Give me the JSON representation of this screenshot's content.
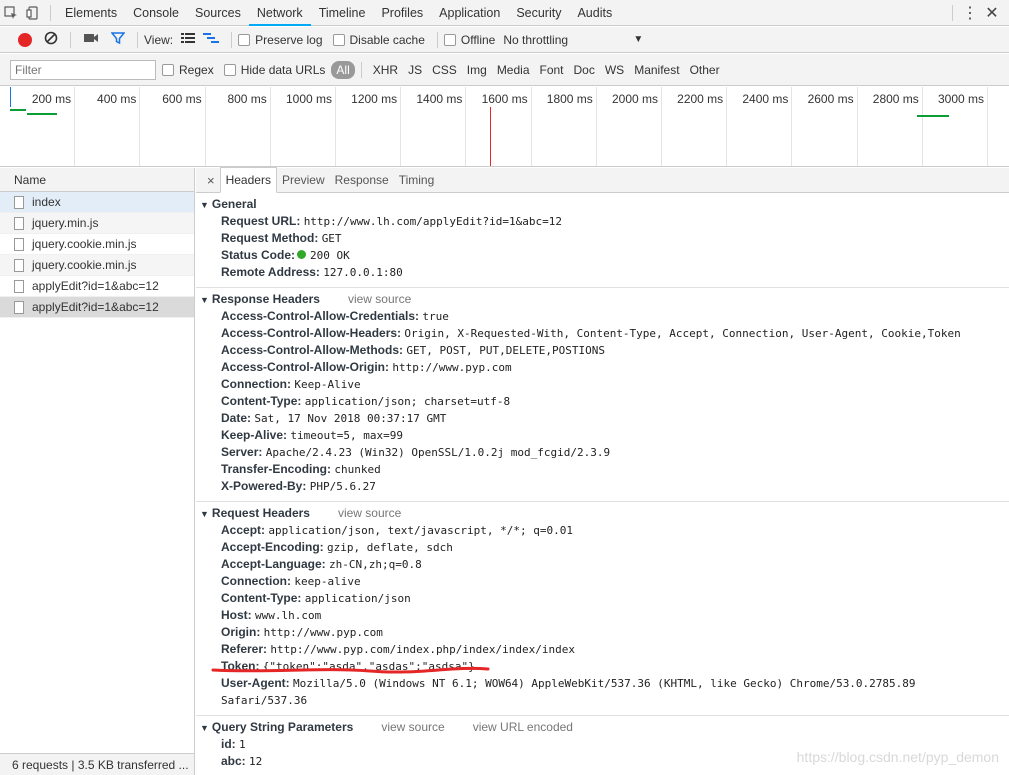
{
  "topbar": {
    "tabs": [
      "Elements",
      "Console",
      "Sources",
      "Network",
      "Timeline",
      "Profiles",
      "Application",
      "Security",
      "Audits"
    ],
    "active_tab": "Network",
    "more_icon": "kebab-icon",
    "close_icon": "close-icon"
  },
  "toolbar": {
    "view_label": "View:",
    "preserve_log": "Preserve log",
    "disable_cache": "Disable cache",
    "offline": "Offline",
    "throttling": "No throttling"
  },
  "filter": {
    "placeholder": "Filter",
    "regex": "Regex",
    "hide_data_urls": "Hide data URLs",
    "types": [
      "All",
      "XHR",
      "JS",
      "CSS",
      "Img",
      "Media",
      "Font",
      "Doc",
      "WS",
      "Manifest",
      "Other"
    ]
  },
  "timeline": {
    "labels": [
      "200 ms",
      "400 ms",
      "600 ms",
      "800 ms",
      "1000 ms",
      "1200 ms",
      "1400 ms",
      "1600 ms",
      "1800 ms",
      "2000 ms",
      "2200 ms",
      "2400 ms",
      "2600 ms",
      "2800 ms",
      "3000 ms",
      "3"
    ]
  },
  "requests": {
    "header": "Name",
    "items": [
      "index",
      "jquery.min.js",
      "jquery.cookie.min.js",
      "jquery.cookie.min.js",
      "applyEdit?id=1&abc=12",
      "applyEdit?id=1&abc=12"
    ],
    "status": "6 requests | 3.5 KB transferred ..."
  },
  "details": {
    "close": "×",
    "tabs": [
      "Headers",
      "Preview",
      "Response",
      "Timing"
    ],
    "general": {
      "title": "General",
      "rows": [
        {
          "k": "Request URL:",
          "v": "http://www.lh.com/applyEdit?id=1&abc=12"
        },
        {
          "k": "Request Method:",
          "v": "GET"
        },
        {
          "k": "Status Code:",
          "v": "200 OK"
        },
        {
          "k": "Remote Address:",
          "v": "127.0.0.1:80"
        }
      ]
    },
    "response_headers": {
      "title": "Response Headers",
      "view_source": "view source",
      "rows": [
        {
          "k": "Access-Control-Allow-Credentials:",
          "v": "true"
        },
        {
          "k": "Access-Control-Allow-Headers:",
          "v": "Origin, X-Requested-With, Content-Type, Accept, Connection, User-Agent, Cookie,Token"
        },
        {
          "k": "Access-Control-Allow-Methods:",
          "v": "GET, POST, PUT,DELETE,POSTIONS"
        },
        {
          "k": "Access-Control-Allow-Origin:",
          "v": "http://www.pyp.com"
        },
        {
          "k": "Connection:",
          "v": "Keep-Alive"
        },
        {
          "k": "Content-Type:",
          "v": "application/json; charset=utf-8"
        },
        {
          "k": "Date:",
          "v": "Sat, 17 Nov 2018 00:37:17 GMT"
        },
        {
          "k": "Keep-Alive:",
          "v": "timeout=5, max=99"
        },
        {
          "k": "Server:",
          "v": "Apache/2.4.23 (Win32) OpenSSL/1.0.2j mod_fcgid/2.3.9"
        },
        {
          "k": "Transfer-Encoding:",
          "v": "chunked"
        },
        {
          "k": "X-Powered-By:",
          "v": "PHP/5.6.27"
        }
      ]
    },
    "request_headers": {
      "title": "Request Headers",
      "view_source": "view source",
      "rows": [
        {
          "k": "Accept:",
          "v": "application/json, text/javascript, */*; q=0.01"
        },
        {
          "k": "Accept-Encoding:",
          "v": "gzip, deflate, sdch"
        },
        {
          "k": "Accept-Language:",
          "v": "zh-CN,zh;q=0.8"
        },
        {
          "k": "Connection:",
          "v": "keep-alive"
        },
        {
          "k": "Content-Type:",
          "v": "application/json"
        },
        {
          "k": "Host:",
          "v": "www.lh.com"
        },
        {
          "k": "Origin:",
          "v": "http://www.pyp.com"
        },
        {
          "k": "Referer:",
          "v": "http://www.pyp.com/index.php/index/index/index"
        },
        {
          "k": "Token:",
          "v": "{\"token\":\"asda\",\"asdas\":\"asdsa\"}"
        }
      ],
      "user_agent_key": "User-Agent:",
      "user_agent_value": "Mozilla/5.0 (Windows NT 6.1; WOW64) AppleWebKit/537.36 (KHTML, like Gecko) Chrome/53.0.2785.89",
      "user_agent_value_2": "Safari/537.36"
    },
    "query_params": {
      "title": "Query String Parameters",
      "view_source": "view source",
      "view_url_encoded": "view URL encoded",
      "rows": [
        {
          "k": "id:",
          "v": "1"
        },
        {
          "k": "abc:",
          "v": "12"
        }
      ]
    }
  },
  "watermark": "https://blog.csdn.net/pyp_demon",
  "colors": {
    "record": "#e52626",
    "status_ok": "#31a829",
    "active_tab_underline": "#03a9f4",
    "annotation": "#e52626"
  }
}
